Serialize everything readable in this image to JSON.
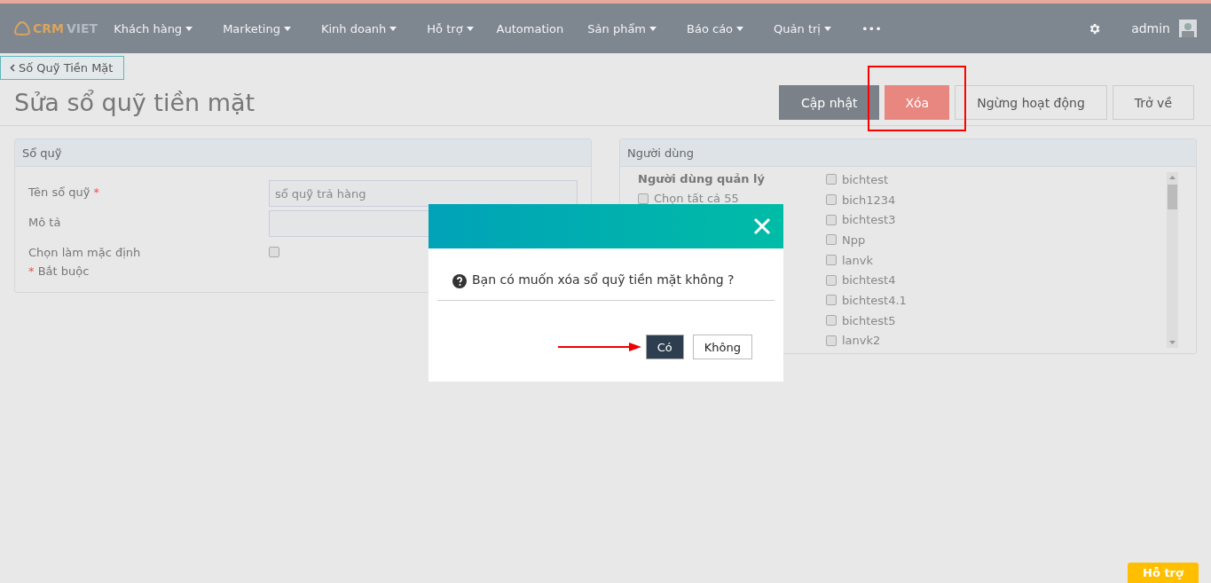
{
  "navbar": {
    "logo": {
      "part_1": "CRM",
      "part_2": "VIET"
    },
    "menu": [
      {
        "label": "Khách hàng",
        "dropdown": true
      },
      {
        "label": "Marketing",
        "dropdown": true
      },
      {
        "label": "Kinh doanh",
        "dropdown": true
      },
      {
        "label": "Hỗ trợ",
        "dropdown": true
      },
      {
        "label": "Automation",
        "dropdown": false
      },
      {
        "label": "Sản phẩm",
        "dropdown": true
      },
      {
        "label": "Báo cáo",
        "dropdown": true
      },
      {
        "label": "Quản trị",
        "dropdown": true
      },
      {
        "label": "•••",
        "dropdown": false
      }
    ],
    "user": "admin"
  },
  "breadcrumb": "Số Quỹ Tiền Mặt",
  "page_title": "Sửa sổ quỹ tiền mặt",
  "actions": [
    {
      "label": "Cập nhật",
      "kind": "primary",
      "highlighted": false
    },
    {
      "label": "Xóa",
      "kind": "danger",
      "highlighted": true
    },
    {
      "label": "Ngừng hoạt động",
      "kind": "default",
      "highlighted": false
    },
    {
      "label": "Trở về",
      "kind": "default",
      "highlighted": false
    }
  ],
  "fund_panel": {
    "title": "Sổ quỹ",
    "fields": [
      {
        "label": "Tên sổ quỹ",
        "required": true,
        "kind": "text",
        "value": "sổ quỹ trả hàng"
      },
      {
        "label": "Mô tả",
        "required": false,
        "kind": "text"
      },
      {
        "label": "Chọn làm mặc định",
        "required": false,
        "kind": "checkbox",
        "checked": false
      }
    ],
    "required_mark": "*",
    "required_note": "Bắt buộc"
  },
  "users_panel": {
    "title": "Người dùng",
    "group_label": "Người dùng quản lý",
    "select_all": {
      "label": "Chọn tất cả 55",
      "checked": false
    },
    "users": [
      {
        "name": "bichtest",
        "checked": false
      },
      {
        "name": "bich1234",
        "checked": false
      },
      {
        "name": "bichtest3",
        "checked": false
      },
      {
        "name": "Npp",
        "checked": false
      },
      {
        "name": "lanvk",
        "checked": false
      },
      {
        "name": "bichtest4",
        "checked": false
      },
      {
        "name": "bichtest4.1",
        "checked": false
      },
      {
        "name": "bichtest5",
        "checked": false
      },
      {
        "name": "lanvk2",
        "checked": false
      }
    ]
  },
  "dialog": {
    "message": "Bạn có muốn xóa sổ quỹ tiền mặt không ?",
    "buttons": [
      {
        "label": "Có",
        "kind": "confirm"
      },
      {
        "label": "Không",
        "kind": "cancel"
      }
    ]
  },
  "help_button": "Hỗ trợ"
}
